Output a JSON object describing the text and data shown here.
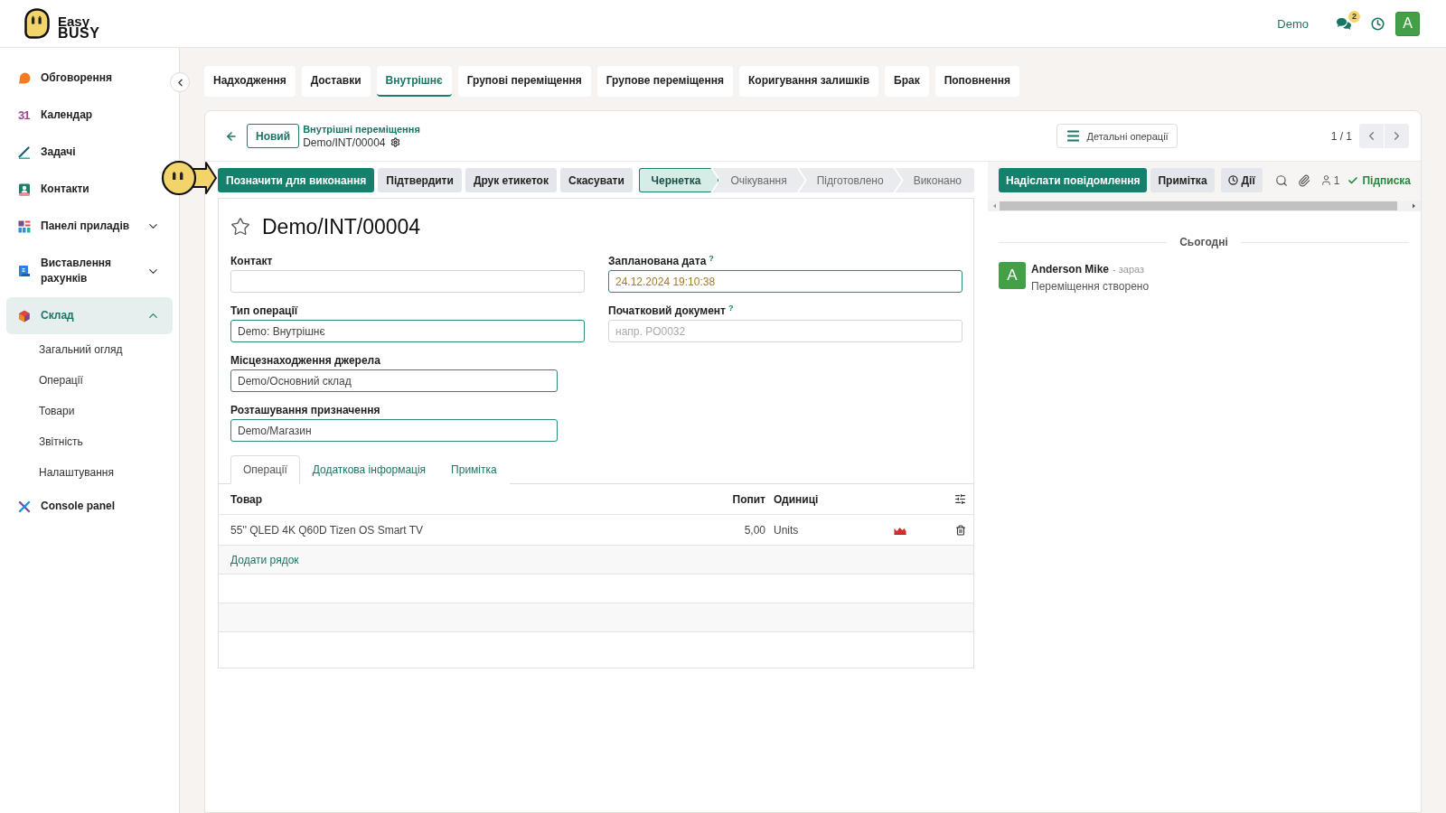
{
  "logo": {
    "line_1": "Easy",
    "line_2": "BUSY"
  },
  "top_bar": {
    "company": "Demo",
    "messages_count": "2",
    "user_initial": "A"
  },
  "sidebar": {
    "items": [
      {
        "label": "Обговорення",
        "kind": "app",
        "selected": false
      },
      {
        "label": "Календар",
        "kind": "app",
        "selected": false,
        "glyph": "31"
      },
      {
        "label": "Задачі",
        "kind": "app",
        "selected": false
      },
      {
        "label": "Контакти",
        "kind": "app",
        "selected": false
      },
      {
        "label": "Панелі приладів",
        "kind": "group",
        "selected": false,
        "expanded": false
      },
      {
        "label": "Виставлення рахунків",
        "kind": "group",
        "selected": false,
        "expanded": false
      },
      {
        "label": "Склад",
        "kind": "group",
        "selected": true,
        "expanded": true,
        "children": [
          {
            "label": "Загальний огляд",
            "selected": false
          },
          {
            "label": "Операції",
            "selected": false
          },
          {
            "label": "Товари",
            "selected": false
          },
          {
            "label": "Звітність",
            "selected": false
          },
          {
            "label": "Налаштування",
            "selected": false
          }
        ]
      },
      {
        "label": "Console panel",
        "kind": "app",
        "selected": false
      }
    ]
  },
  "tabs": [
    {
      "label": "Надходження",
      "selected": false
    },
    {
      "label": "Доставки",
      "selected": false
    },
    {
      "label": "Внутрішнє",
      "selected": true
    },
    {
      "label": "Групові переміщення",
      "selected": false
    },
    {
      "label": "Групове переміщення",
      "selected": false
    },
    {
      "label": "Коригування залишків",
      "selected": false
    },
    {
      "label": "Брак",
      "selected": false
    },
    {
      "label": "Поповнення",
      "selected": false
    }
  ],
  "record": {
    "new_button": "Новий",
    "breadcrumb_parent": "Внутрішні переміщення",
    "breadcrumb_current": "Demo/INT/00004",
    "details_button": "Детальні операції",
    "pager": "1 / 1"
  },
  "actions": [
    {
      "label": "Позначити для виконання",
      "kind": "primary"
    },
    {
      "label": "Підтвердити",
      "kind": "secondary"
    },
    {
      "label": "Друк етикеток",
      "kind": "secondary"
    },
    {
      "label": "Скасувати",
      "kind": "secondary"
    }
  ],
  "status_steps": [
    {
      "label": "Чернетка",
      "selected": true
    },
    {
      "label": "Очікування",
      "selected": false
    },
    {
      "label": "Підготовлено",
      "selected": false
    },
    {
      "label": "Виконано",
      "selected": false
    }
  ],
  "sheet": {
    "title": "Demo/INT/00004",
    "starred": false,
    "left_fields": [
      {
        "label": "Контакт",
        "kind": "text",
        "required": false
      },
      {
        "label": "Тип операції",
        "kind": "text",
        "required": true,
        "value": "Demo: Внутрішнє"
      }
    ],
    "right_fields": [
      {
        "label": "Запланована дата",
        "help": "?",
        "kind": "date",
        "required": true,
        "value": "24.12.2024 19:10:38"
      },
      {
        "label": "Початковий документ",
        "help": "?",
        "kind": "text",
        "required": false,
        "placeholder": "напр. PO0032"
      }
    ],
    "location_fields": [
      {
        "label": "Місцезнаходження джерела",
        "kind": "text",
        "required": true,
        "value": "Demo/Основний склад"
      },
      {
        "label": "Розташування призначення",
        "kind": "text",
        "required": true,
        "value": "Demo/Магазин"
      }
    ],
    "notebook_tabs": [
      {
        "label": "Операції",
        "selected": true
      },
      {
        "label": "Додаткова інформація",
        "selected": false
      },
      {
        "label": "Примітка",
        "selected": false
      }
    ],
    "table": {
      "columns": [
        "Товар",
        "Попит",
        "Одиниці"
      ],
      "rows": [
        {
          "product": "55'' QLED 4K Q60D Tizen OS Smart TV",
          "demand": "5,00",
          "units": "Units"
        }
      ],
      "add_line": "Додати рядок"
    }
  },
  "chatter": {
    "send_button": "Надіслати повідомлення",
    "note_button": "Примітка",
    "activities_button": "Дії",
    "followers_count": "1",
    "follow_label": "Підписка",
    "following": true,
    "day_divider": "Сьогодні",
    "messages": [
      {
        "initial": "A",
        "author": "Anderson Mike",
        "time": "- зараз",
        "body": "Переміщення створено"
      }
    ]
  }
}
